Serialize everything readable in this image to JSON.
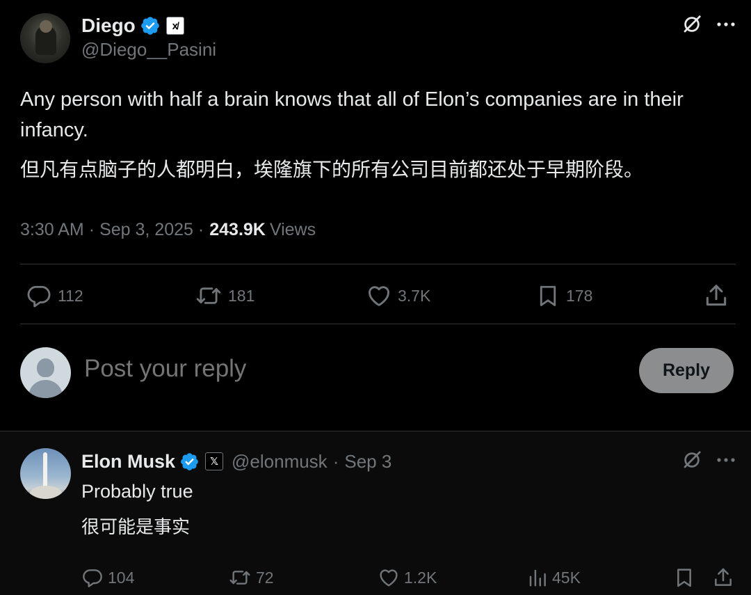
{
  "main_post": {
    "author_name": "Diego",
    "author_handle": "@Diego__Pasini",
    "affiliation_badge": "x̸",
    "text_en": "Any person with half a brain knows that all of Elon’s companies are in their infancy.",
    "text_cn": "但凡有点脑子的人都明白，埃隆旗下的所有公司目前都还处于早期阶段。",
    "time": "3:30 AM",
    "date": "Sep 3, 2025",
    "views_count": "243.9K",
    "views_label": "Views",
    "separator": "·",
    "stats": {
      "replies": "112",
      "reposts": "181",
      "likes": "3.7K",
      "bookmarks": "178"
    }
  },
  "compose": {
    "placeholder": "Post your reply",
    "button_label": "Reply"
  },
  "reply_post": {
    "author_name": "Elon Musk",
    "author_handle": "@elonmusk",
    "affiliation_badge": "𝕏",
    "date": "Sep 3",
    "separator": "·",
    "text_en": "Probably true",
    "text_cn": "很可能是事实",
    "stats": {
      "replies": "104",
      "reposts": "72",
      "likes": "1.2K",
      "views": "45K"
    }
  },
  "colors": {
    "background": "#000000",
    "text": "#e7e9ea",
    "muted": "#71767b",
    "verified": "#1d9bf0",
    "divider": "#2f3336",
    "reply_button": "#8b8d8f"
  },
  "icons": [
    "grok-icon",
    "more-icon",
    "reply-icon",
    "repost-icon",
    "like-icon",
    "bookmark-icon",
    "share-icon",
    "views-icon",
    "verified-icon"
  ]
}
